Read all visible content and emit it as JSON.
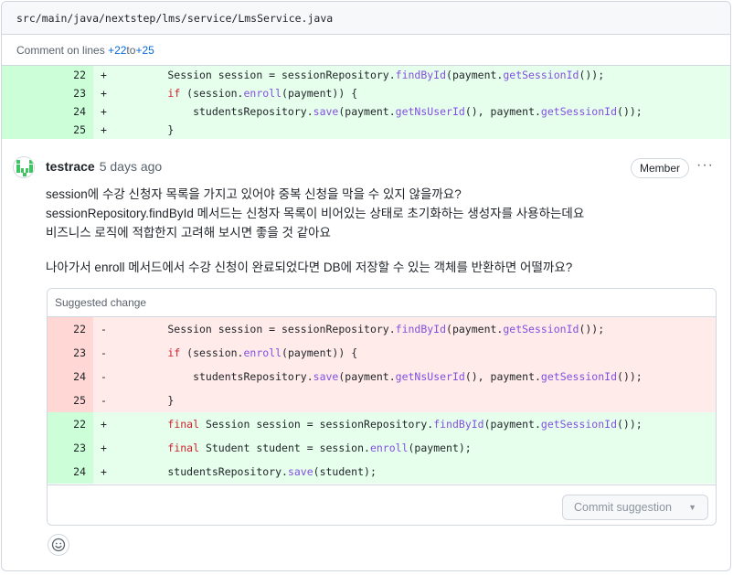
{
  "file": {
    "path": "src/main/java/nextstep/lms/service/LmsService.java"
  },
  "comment_lines": {
    "prefix": "Comment on lines ",
    "start": "+22",
    "to": " to ",
    "end": "+25"
  },
  "diff": [
    {
      "num": "22",
      "sign": "+",
      "parts": [
        [
          "",
          "        Session session = sessionRepository."
        ],
        [
          "fn",
          "findById"
        ],
        [
          "",
          "(payment."
        ],
        [
          "fn",
          "getSessionId"
        ],
        [
          "",
          "());"
        ]
      ]
    },
    {
      "num": "23",
      "sign": "+",
      "parts": [
        [
          "",
          "        "
        ],
        [
          "kw",
          "if"
        ],
        [
          "",
          " (session."
        ],
        [
          "fn",
          "enroll"
        ],
        [
          "",
          "(payment)) {"
        ]
      ]
    },
    {
      "num": "24",
      "sign": "+",
      "parts": [
        [
          "",
          "            studentsRepository."
        ],
        [
          "fn",
          "save"
        ],
        [
          "",
          "(payment."
        ],
        [
          "fn",
          "getNsUserId"
        ],
        [
          "",
          "(), payment."
        ],
        [
          "fn",
          "getSessionId"
        ],
        [
          "",
          "());"
        ]
      ]
    },
    {
      "num": "25",
      "sign": "+",
      "parts": [
        [
          "",
          "        }"
        ]
      ]
    }
  ],
  "comment": {
    "author": "testrace",
    "time": "5 days ago",
    "badge": "Member",
    "more": "···",
    "body": [
      "session에 수강 신청자 목록을 가지고 있어야 중복 신청을 막을 수 있지 않을까요?",
      "sessionRepository.findById 메서드는 신청자 목록이 비어있는 상태로 초기화하는 생성자를 사용하는데요",
      "비즈니스 로직에 적합한지 고려해 보시면 좋을 것 같아요",
      "나아가서 enroll 메서드에서 수강 신청이 완료되었다면 DB에 저장할 수 있는 객체를 반환하면 어떨까요?"
    ]
  },
  "suggestion": {
    "title": "Suggested change",
    "rows": [
      {
        "type": "del",
        "num": "22",
        "sign": "-",
        "parts": [
          [
            "",
            "        Session session = sessionRepository."
          ],
          [
            "fn",
            "findById"
          ],
          [
            "",
            "(payment."
          ],
          [
            "fn",
            "getSessionId"
          ],
          [
            "",
            "());"
          ]
        ]
      },
      {
        "type": "del",
        "num": "23",
        "sign": "-",
        "parts": [
          [
            "",
            "        "
          ],
          [
            "kw",
            "if"
          ],
          [
            "",
            " (session."
          ],
          [
            "fn",
            "enroll"
          ],
          [
            "",
            "(payment)) {"
          ]
        ]
      },
      {
        "type": "del",
        "num": "24",
        "sign": "-",
        "parts": [
          [
            "",
            "            studentsRepository."
          ],
          [
            "fn",
            "save"
          ],
          [
            "",
            "(payment."
          ],
          [
            "fn",
            "getNsUserId"
          ],
          [
            "",
            "(), payment."
          ],
          [
            "fn",
            "getSessionId"
          ],
          [
            "",
            "());"
          ]
        ]
      },
      {
        "type": "del",
        "num": "25",
        "sign": "-",
        "parts": [
          [
            "",
            "        }"
          ]
        ]
      },
      {
        "type": "add",
        "num": "22",
        "sign": "+",
        "parts": [
          [
            "",
            "        "
          ],
          [
            "kw",
            "final"
          ],
          [
            "",
            " Session session = sessionRepository."
          ],
          [
            "fn",
            "findById"
          ],
          [
            "",
            "(payment."
          ],
          [
            "fn",
            "getSessionId"
          ],
          [
            "",
            "());"
          ]
        ]
      },
      {
        "type": "add",
        "num": "23",
        "sign": "+",
        "parts": [
          [
            "",
            "        "
          ],
          [
            "kw",
            "final"
          ],
          [
            "",
            " Student student = session."
          ],
          [
            "fn",
            "enroll"
          ],
          [
            "",
            "(payment);"
          ]
        ]
      },
      {
        "type": "add",
        "num": "24",
        "sign": "+",
        "parts": [
          [
            "",
            "        studentsRepository."
          ],
          [
            "fn",
            "save"
          ],
          [
            "",
            "(student);"
          ]
        ]
      }
    ],
    "commit_label": "Commit suggestion",
    "commit_caret": "▼"
  },
  "icons": {
    "avatar": "identicon-avatar",
    "emoji": "smiley-icon",
    "more": "kebab-horizontal-icon",
    "caret": "triangle-down-icon"
  },
  "colors": {
    "add_bg": "#e6ffec",
    "add_num_bg": "#ccffd8",
    "del_bg": "#ffebe9",
    "del_num_bg": "#ffd7d5",
    "link": "#0969da",
    "keyword": "#cf222e",
    "function": "#8250df",
    "avatar_green": "#40c463"
  }
}
